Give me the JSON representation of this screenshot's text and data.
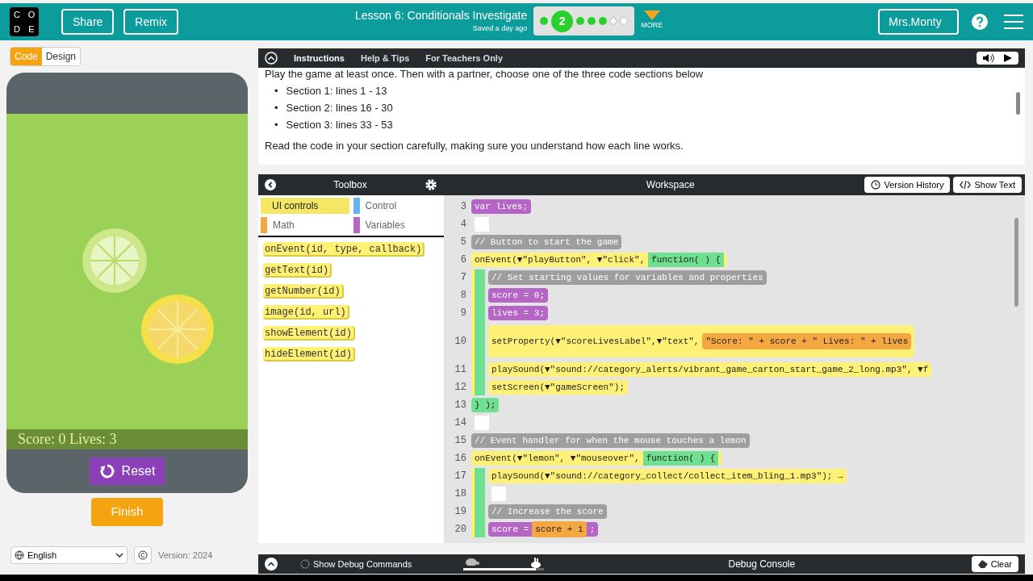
{
  "header": {
    "logo": [
      "C",
      "O",
      "D",
      "E"
    ],
    "share": "Share",
    "remix": "Remix",
    "lesson_title": "Lesson 6: Conditionals Investigate",
    "saved": "Saved a day ago",
    "progress": [
      {
        "kind": "done"
      },
      {
        "kind": "current",
        "label": "2"
      },
      {
        "kind": "done"
      },
      {
        "kind": "done"
      },
      {
        "kind": "done"
      },
      {
        "kind": "assessment"
      },
      {
        "kind": "open"
      }
    ],
    "more": "MORE",
    "user": "Mrs.Monty"
  },
  "mode_toggle": [
    {
      "label": "Code",
      "selected": true
    },
    {
      "label": "Design",
      "selected": false
    }
  ],
  "app": {
    "score_label": "Score: 0 Lives: 3",
    "reset": "Reset",
    "finish": "Finish"
  },
  "footer": {
    "language": "English",
    "version": "Version: 2024"
  },
  "instructions": {
    "tabs": [
      {
        "label": "Instructions",
        "selected": true
      },
      {
        "label": "Help & Tips",
        "selected": false
      },
      {
        "label": "For Teachers Only",
        "selected": false
      }
    ],
    "intro": "Play the game at least once. Then with a partner, choose one of the three code sections below",
    "bullets": [
      {
        "marker": "•",
        "text": "Section 1: lines 1 - 13"
      },
      {
        "marker": "•",
        "text": "Section 2: lines 16 - 30"
      },
      {
        "marker": "•",
        "text": "Section 3: lines 33 - 53"
      }
    ],
    "note": "Read the code in your section carefully, making sure you understand how each line works."
  },
  "toolbox": {
    "title": "Toolbox",
    "categories": [
      {
        "label": "UI controls",
        "color": "#f5e663",
        "selected": true
      },
      {
        "label": "Control",
        "color": "#64b5f6",
        "selected": false
      },
      {
        "label": "Math",
        "color": "#f5a742",
        "selected": false
      },
      {
        "label": "Variables",
        "color": "#b565c6",
        "selected": false
      }
    ],
    "blocks": [
      "onEvent(id, type, callback)",
      "getText(id)",
      "getNumber(id)",
      "image(id, url)",
      "showElement(id)",
      "hideElement(id)"
    ]
  },
  "workspace": {
    "title": "Workspace",
    "version_history": "Version History",
    "show_text": "Show Text",
    "lines": [
      {
        "num": "3",
        "kind": "var",
        "text": "var lives;"
      },
      {
        "num": "4",
        "kind": "blank"
      },
      {
        "num": "5",
        "kind": "comment",
        "text": "// Button to start the game"
      },
      {
        "num": "6",
        "kind": "event",
        "text": "onEvent(▼\"playButton\", ▼\"click\",",
        "fn": "function( ) {",
        "children": [
          {
            "num": "7",
            "kind": "comment",
            "text": "// Set starting values for variables and properties"
          },
          {
            "num": "8",
            "kind": "var",
            "text": "score = 0;"
          },
          {
            "num": "9",
            "kind": "var",
            "text": "lives = 3;"
          },
          {
            "num": "10",
            "kind": "call",
            "text": "setProperty(▼\"scoreLivesLabel\",▼\"text\",",
            "expr": "\"Score: \" + score + \" Lives: \" + lives"
          },
          {
            "num": "11",
            "kind": "call",
            "text": "playSound(▼\"sound://category_alerts/vibrant_game_carton_start_game_2_long.mp3\", ▼f"
          },
          {
            "num": "12",
            "kind": "call",
            "text": "setScreen(▼\"gameScreen\");"
          }
        ]
      },
      {
        "num": "13",
        "kind": "close",
        "text": "} );"
      },
      {
        "num": "14",
        "kind": "blank"
      },
      {
        "num": "15",
        "kind": "comment",
        "text": "// Event handler for when the mouse touches a lemon"
      },
      {
        "num": "16",
        "kind": "event",
        "text": "onEvent(▼\"lemon\", ▼\"mouseover\",",
        "fn": "function( ) {",
        "children": [
          {
            "num": "17",
            "kind": "call",
            "text": "playSound(▼\"sound://category_collect/collect_item_bling_1.mp3\"); →"
          },
          {
            "num": "18",
            "kind": "blank"
          },
          {
            "num": "19",
            "kind": "comment",
            "text": "// Increase the score"
          },
          {
            "num": "20",
            "kind": "var",
            "text": "score =",
            "expr": "score + 1",
            "tail": ";"
          }
        ]
      }
    ]
  },
  "debug": {
    "show_commands": "Show Debug Commands",
    "speed": {
      "level": 0.9
    },
    "console": "Debug Console",
    "clear": "Clear"
  }
}
